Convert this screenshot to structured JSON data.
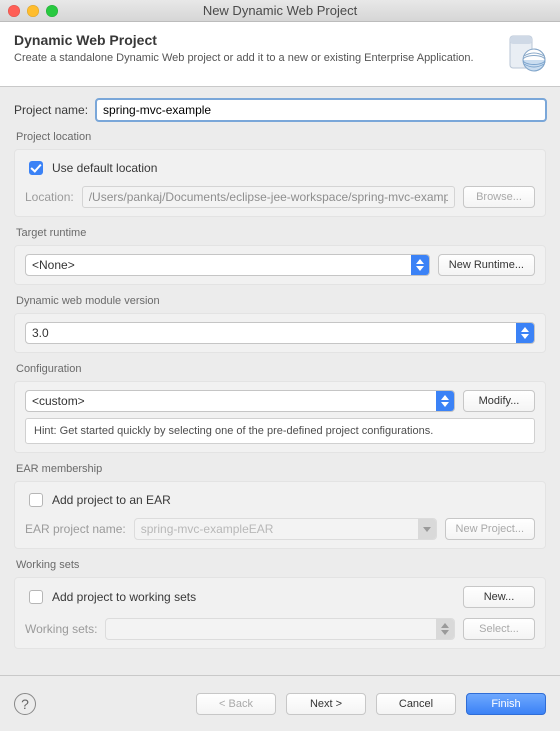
{
  "window_title": "New Dynamic Web Project",
  "banner": {
    "title": "Dynamic Web Project",
    "subtitle": "Create a standalone Dynamic Web project or add it to a new or existing Enterprise Application."
  },
  "project_name": {
    "label": "Project name:",
    "value": "spring-mvc-example"
  },
  "location": {
    "section": "Project location",
    "use_default_label": "Use default location",
    "use_default_checked": true,
    "label": "Location:",
    "value": "/Users/pankaj/Documents/eclipse-jee-workspace/spring-mvc-example",
    "browse": "Browse..."
  },
  "runtime": {
    "section": "Target runtime",
    "value": "<None>",
    "button": "New Runtime..."
  },
  "module_version": {
    "section": "Dynamic web module version",
    "value": "3.0"
  },
  "configuration": {
    "section": "Configuration",
    "value": "<custom>",
    "modify": "Modify...",
    "hint": "Hint: Get started quickly by selecting one of the pre-defined project configurations."
  },
  "ear": {
    "section": "EAR membership",
    "add_label": "Add project to an EAR",
    "add_checked": false,
    "name_label": "EAR project name:",
    "name_value": "spring-mvc-exampleEAR",
    "new_project": "New Project..."
  },
  "working_sets": {
    "section": "Working sets",
    "add_label": "Add project to working sets",
    "add_checked": false,
    "new": "New...",
    "label": "Working sets:",
    "value": "",
    "select": "Select..."
  },
  "footer": {
    "back": "< Back",
    "next": "Next >",
    "cancel": "Cancel",
    "finish": "Finish"
  }
}
